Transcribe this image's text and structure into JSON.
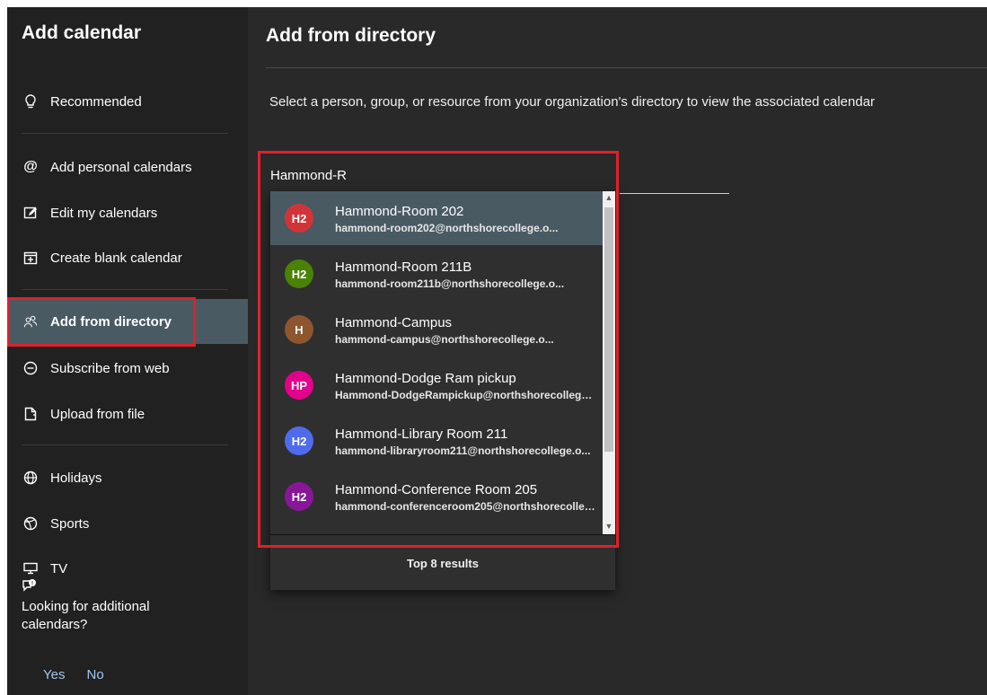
{
  "sidebar": {
    "title": "Add calendar",
    "items": [
      {
        "label": "Recommended",
        "icon": "lightbulb-icon"
      },
      {
        "label": "Add personal calendars",
        "icon": "at-icon"
      },
      {
        "label": "Edit my calendars",
        "icon": "edit-icon"
      },
      {
        "label": "Create blank calendar",
        "icon": "calendar-add-icon"
      },
      {
        "label": "Add from directory",
        "icon": "people-icon",
        "active": true
      },
      {
        "label": "Subscribe from web",
        "icon": "link-circle-icon"
      },
      {
        "label": "Upload from file",
        "icon": "file-upload-icon"
      },
      {
        "label": "Holidays",
        "icon": "globe-icon"
      },
      {
        "label": "Sports",
        "icon": "ball-icon"
      },
      {
        "label": "TV",
        "icon": "tv-icon"
      }
    ],
    "feedback": {
      "icon": "feedback-icon",
      "question": "Looking for additional calendars?",
      "yes": "Yes",
      "no": "No"
    }
  },
  "main": {
    "title": "Add from directory",
    "description": "Select a person, group, or resource from your organization's directory to view the associated calendar",
    "search": {
      "value": "Hammond-R"
    },
    "results": [
      {
        "initials": "H2",
        "name": "Hammond-Room 202",
        "email": "hammond-room202@northshorecollege.o...",
        "color": "#d13438",
        "selected": true
      },
      {
        "initials": "H2",
        "name": "Hammond-Room 211B",
        "email": "hammond-room211b@northshorecollege.o...",
        "color": "#498205"
      },
      {
        "initials": "H",
        "name": "Hammond-Campus",
        "email": "hammond-campus@northshorecollege.o...",
        "color": "#8e562e"
      },
      {
        "initials": "HP",
        "name": "Hammond-Dodge Ram pickup",
        "email": "Hammond-DodgeRampickup@northshorecollege.o...",
        "color": "#e3008c"
      },
      {
        "initials": "H2",
        "name": "Hammond-Library Room 211",
        "email": "hammond-libraryroom211@northshorecollege.o...",
        "color": "#4f6bed"
      },
      {
        "initials": "H2",
        "name": "Hammond-Conference Room 205",
        "email": "hammond-conferenceroom205@northshorecollege.o...",
        "color": "#881798"
      }
    ],
    "results_footer": "Top 8 results"
  },
  "colors": {
    "sidebar_bg": "#212121",
    "main_bg": "#292929",
    "active_bg": "#4a5a63",
    "highlight": "#e0202a",
    "link": "#9fc6ee"
  }
}
